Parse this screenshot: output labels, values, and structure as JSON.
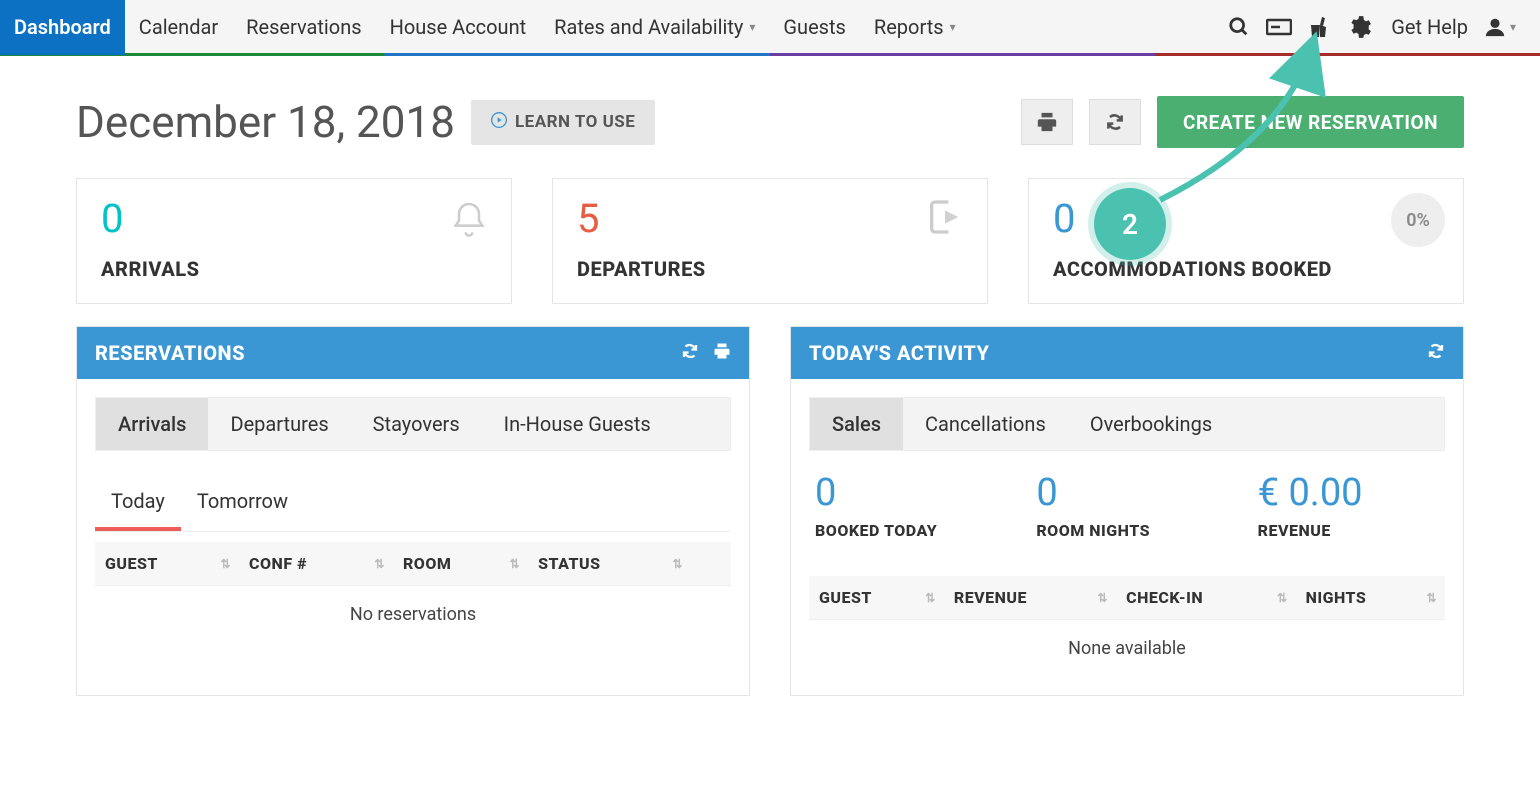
{
  "nav": {
    "items": [
      {
        "label": "Dashboard",
        "active": true
      },
      {
        "label": "Calendar"
      },
      {
        "label": "Reservations"
      },
      {
        "label": "House Account"
      },
      {
        "label": "Rates and Availability",
        "dropdown": true
      },
      {
        "label": "Guests"
      },
      {
        "label": "Reports",
        "dropdown": true
      }
    ],
    "get_help": "Get Help"
  },
  "header": {
    "date_title": "December 18, 2018",
    "learn_label": "LEARN TO USE",
    "create_label": "CREATE NEW RESERVATION"
  },
  "stat_cards": {
    "arrivals": {
      "value": "0",
      "label": "ARRIVALS"
    },
    "departures": {
      "value": "5",
      "label": "DEPARTURES"
    },
    "accom": {
      "value": "0",
      "label": "ACCOMMODATIONS BOOKED",
      "pct": "0%"
    }
  },
  "reservations_panel": {
    "title": "RESERVATIONS",
    "tabs": [
      "Arrivals",
      "Departures",
      "Stayovers",
      "In-House Guests"
    ],
    "subtabs": [
      "Today",
      "Tomorrow"
    ],
    "columns": [
      "GUEST",
      "CONF #",
      "ROOM",
      "STATUS"
    ],
    "empty_text": "No reservations"
  },
  "activity_panel": {
    "title": "TODAY'S ACTIVITY",
    "tabs": [
      "Sales",
      "Cancellations",
      "Overbookings"
    ],
    "stats": {
      "booked": {
        "value": "0",
        "label": "BOOKED TODAY"
      },
      "nights": {
        "value": "0",
        "label": "ROOM NIGHTS"
      },
      "revenue": {
        "value": "€ 0.00",
        "label": "REVENUE"
      }
    },
    "columns": [
      "GUEST",
      "REVENUE",
      "CHECK-IN",
      "NIGHTS"
    ],
    "empty_text": "None available"
  },
  "annotation": {
    "step": "2"
  }
}
